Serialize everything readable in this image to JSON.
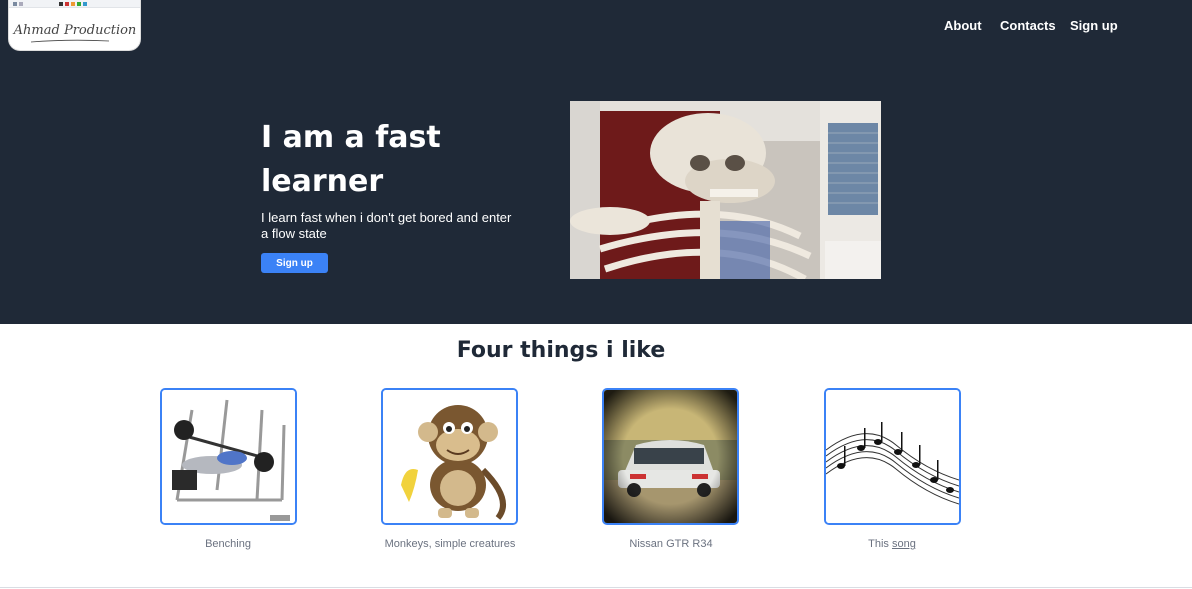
{
  "logo": {
    "text": "Ahmad Production"
  },
  "nav": {
    "items": [
      {
        "label": "About"
      },
      {
        "label": "Contacts"
      },
      {
        "label": "Sign up"
      }
    ]
  },
  "hero": {
    "title": "I am a fast learner",
    "subtitle": "I learn fast when i don't get bored and enter a flow state",
    "button": "Sign up",
    "image_icon": "skeleton-photo"
  },
  "likes": {
    "title": "Four things i like",
    "items": [
      {
        "caption": "Benching",
        "icon": "bench-press-illustration"
      },
      {
        "caption": "Monkeys, simple creatures",
        "icon": "monkey-with-banana"
      },
      {
        "caption": "Nissan GTR R34",
        "icon": "nissan-gtr-car-photo"
      },
      {
        "caption_prefix": "This",
        "link": "song",
        "icon": "music-notes"
      }
    ]
  },
  "colors": {
    "header_bg": "#1f2937",
    "accent": "#3b82f6",
    "caption": "#6b7280"
  }
}
